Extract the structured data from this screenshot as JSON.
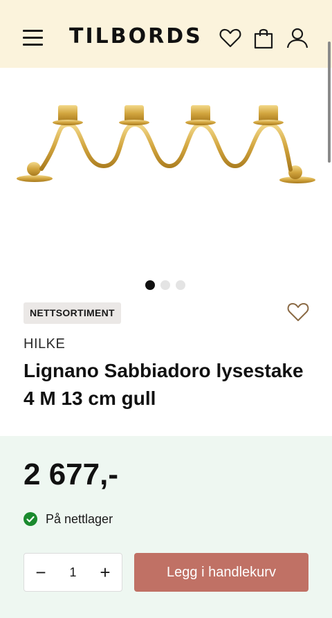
{
  "header": {
    "logo": "TILBORDS",
    "icons": [
      "menu-icon",
      "heart-icon",
      "bag-icon",
      "user-icon"
    ]
  },
  "gallery": {
    "image_subject": "gold four-armed candle holder",
    "dots_count": 3,
    "active_dot": 1
  },
  "product": {
    "badge": "NETTSORTIMENT",
    "brand": "HILKE",
    "title_line1": "Lignano Sabbiadoro lysestake",
    "title_line2": "4 M 13 cm gull",
    "price": "2 677,-",
    "stock_text": "På nettlager",
    "quantity": "1",
    "add_to_cart_label": "Legg i handlekurv",
    "minus_label": "−",
    "plus_label": "+"
  },
  "colors": {
    "header_bg": "#fbf3dc",
    "buy_panel_bg": "#eef7f1",
    "cta": "#c07165",
    "stock_green": "#1a8a2e",
    "badge_bg": "#ebe8e6"
  }
}
